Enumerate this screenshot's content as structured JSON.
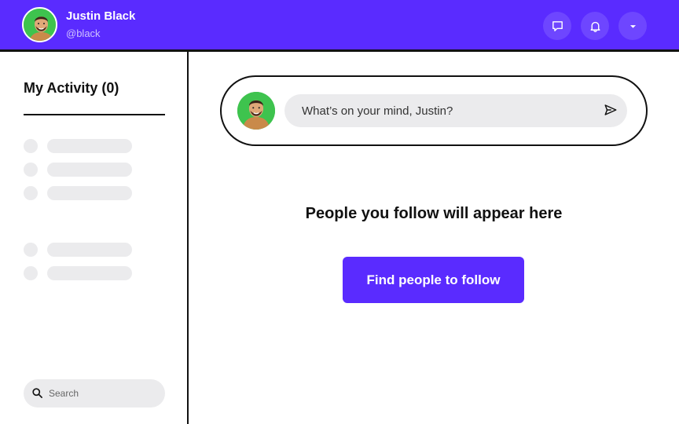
{
  "header": {
    "user_name": "Justin Black",
    "user_handle": "@black",
    "icons": [
      "chat-icon",
      "bell-icon",
      "chevron-down-icon"
    ]
  },
  "sidebar": {
    "title": "My Activity (0)",
    "search_placeholder": "Search"
  },
  "composer": {
    "placeholder": "What’s on your mind, Justin?"
  },
  "main": {
    "empty_message": "People you follow will appear here",
    "find_button_label": "Find people to follow"
  },
  "colors": {
    "brand": "#5a2bff",
    "skeleton": "#ebebed",
    "avatar_bg": "#3ec34e"
  }
}
